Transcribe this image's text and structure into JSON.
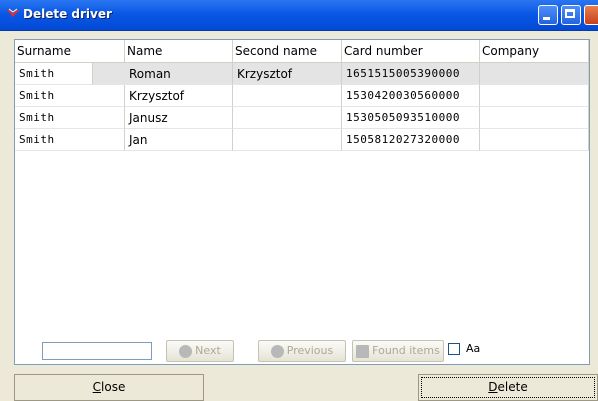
{
  "window": {
    "title": "Delete driver",
    "icon": "app-logo-icon"
  },
  "grid": {
    "columns": [
      "Surname",
      "Name",
      "Second name",
      "Card number",
      "Company"
    ],
    "rows": [
      {
        "surname": "Smith",
        "name": "Roman",
        "second_name": "Krzysztof",
        "card_number": "1651515005390000",
        "company": ""
      },
      {
        "surname": "Smith",
        "name": "Krzysztof",
        "second_name": "",
        "card_number": "1530420030560000",
        "company": ""
      },
      {
        "surname": "Smith",
        "name": "Janusz",
        "second_name": "",
        "card_number": "1530505093510000",
        "company": ""
      },
      {
        "surname": "Smith",
        "name": "Jan",
        "second_name": "",
        "card_number": "1505812027320000",
        "company": ""
      }
    ]
  },
  "search": {
    "value": "",
    "next_label": "Next",
    "previous_label": "Previous",
    "found_items_label": "Found items",
    "match_case_label": "Aa",
    "match_case_checked": false
  },
  "buttons": {
    "close_label": "Close",
    "delete_label": "Delete"
  },
  "colors": {
    "titlebar": "#0a58e6",
    "selected_row": "#e4e4e4"
  }
}
